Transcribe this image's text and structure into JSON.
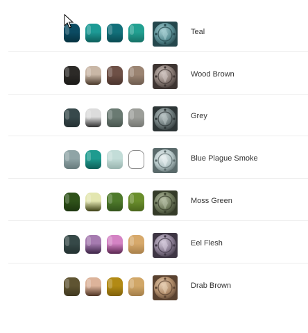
{
  "schemes": [
    {
      "name": "Teal",
      "pots": [
        {
          "color": "#0b4b62",
          "shade": "#06323f"
        },
        {
          "color": "#1d9a95",
          "shade": "#0e5e5b"
        },
        {
          "color": "#12707a",
          "shade": "#0a4a52"
        },
        {
          "color": "#22a091",
          "shade": "#167066"
        }
      ],
      "model": {
        "base": "#5b8f95",
        "light": "#a7cfd3",
        "dark": "#24474c"
      }
    },
    {
      "name": "Wood Brown",
      "pots": [
        {
          "color": "#2c2a27",
          "shade": "#1b1a18"
        },
        {
          "color": "#c9b7a6",
          "shade": "#4b3a2c"
        },
        {
          "color": "#6e5046",
          "shade": "#4a342d"
        },
        {
          "color": "#9b8472",
          "shade": "#6d5b4e"
        }
      ],
      "model": {
        "base": "#8a7c76",
        "light": "#d2c7c2",
        "dark": "#3e3532"
      }
    },
    {
      "name": "Grey",
      "pots": [
        {
          "color": "#37494b",
          "shade": "#243032"
        },
        {
          "color": "#dcdcdc",
          "shade": "#2e2e2e"
        },
        {
          "color": "#6a7a72",
          "shade": "#48544e"
        },
        {
          "color": "#9c9e99",
          "shade": "#747672"
        }
      ],
      "model": {
        "base": "#6f7c7d",
        "light": "#bcc6c7",
        "dark": "#2d3536"
      }
    },
    {
      "name": "Blue Plague Smoke",
      "pots": [
        {
          "color": "#8fa4a6",
          "shade": "#677a7c"
        },
        {
          "color": "#1e9b8f",
          "shade": "#0f5f58"
        },
        {
          "color": "#c3ddd8",
          "shade": "#98b3ae"
        },
        {
          "color": "#ffffff",
          "shade": "#ffffff",
          "outline": true
        }
      ],
      "model": {
        "base": "#b7c8c9",
        "light": "#eaf1f2",
        "dark": "#5a6a6b"
      }
    },
    {
      "name": "Moss Green",
      "pots": [
        {
          "color": "#2f5219",
          "shade": "#1d3610"
        },
        {
          "color": "#e3e6b0",
          "shade": "#3c3f14"
        },
        {
          "color": "#4e7a2b",
          "shade": "#33531b"
        },
        {
          "color": "#6a8e2c",
          "shade": "#4a661d"
        }
      ],
      "model": {
        "base": "#6f7a5c",
        "light": "#b7bfa5",
        "dark": "#343b28"
      }
    },
    {
      "name": "Eel Flesh",
      "pots": [
        {
          "color": "#364948",
          "shade": "#233130"
        },
        {
          "color": "#a67bb0",
          "shade": "#3c2446"
        },
        {
          "color": "#d483c4",
          "shade": "#5a2650"
        },
        {
          "color": "#d7a96b",
          "shade": "#a8804b"
        }
      ],
      "model": {
        "base": "#8c7f95",
        "light": "#d5cbdc",
        "dark": "#3e3644"
      }
    },
    {
      "name": "Drab Brown",
      "pots": [
        {
          "color": "#5f5432",
          "shade": "#3f371f"
        },
        {
          "color": "#dcb39a",
          "shade": "#4c3222"
        },
        {
          "color": "#b28a14",
          "shade": "#7f600a"
        },
        {
          "color": "#d1a768",
          "shade": "#a27d48"
        }
      ],
      "model": {
        "base": "#b08c6a",
        "light": "#e8cfb4",
        "dark": "#5a4230"
      }
    }
  ]
}
